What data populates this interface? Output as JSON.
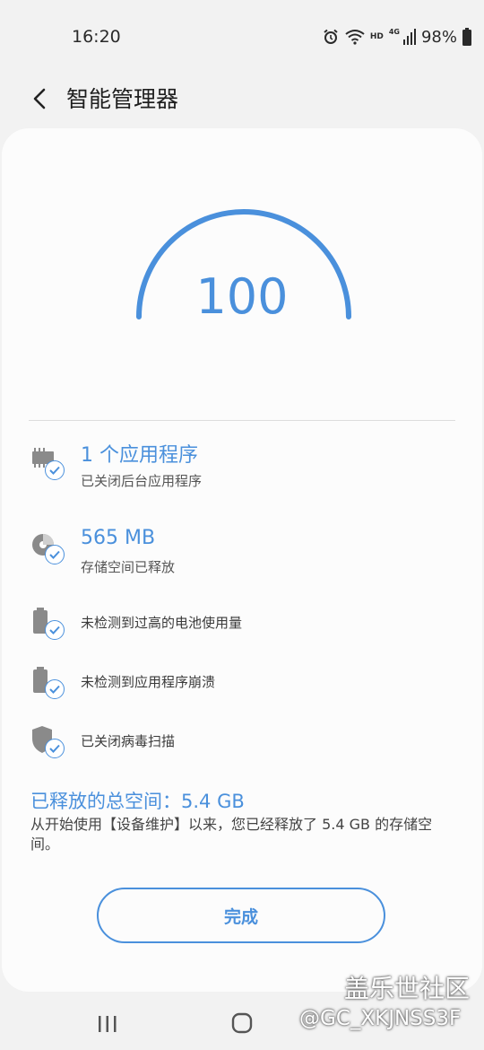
{
  "status_bar": {
    "time": "16:20",
    "hd_label": "HD",
    "network_label": "4G",
    "battery": "98%",
    "icons": [
      "alarm-icon",
      "wifi-icon",
      "signal-icon",
      "battery-icon"
    ]
  },
  "header": {
    "title": "智能管理器",
    "back_icon": "chevron-left-icon"
  },
  "gauge": {
    "score": "100",
    "accent_color": "#4a90dc"
  },
  "results": [
    {
      "icon": "memory-icon",
      "title": "1 个应用程序",
      "subtitle": "已关闭后台应用程序"
    },
    {
      "icon": "storage-icon",
      "title": "565 MB",
      "subtitle": "存储空间已释放"
    },
    {
      "icon": "battery-icon",
      "text": "未检测到过高的电池使用量"
    },
    {
      "icon": "battery-icon",
      "text": "未检测到应用程序崩溃"
    },
    {
      "icon": "shield-icon",
      "text": "已关闭病毒扫描"
    }
  ],
  "summary": {
    "title": "已释放的总空间：5.4 GB",
    "description": "从开始使用【设备维护】以来，您已经释放了 5.4 GB 的存储空间。"
  },
  "done_button": "完成",
  "watermark": {
    "line1": "盖乐世社区",
    "line2": "@GC_XKJNSS3F"
  }
}
